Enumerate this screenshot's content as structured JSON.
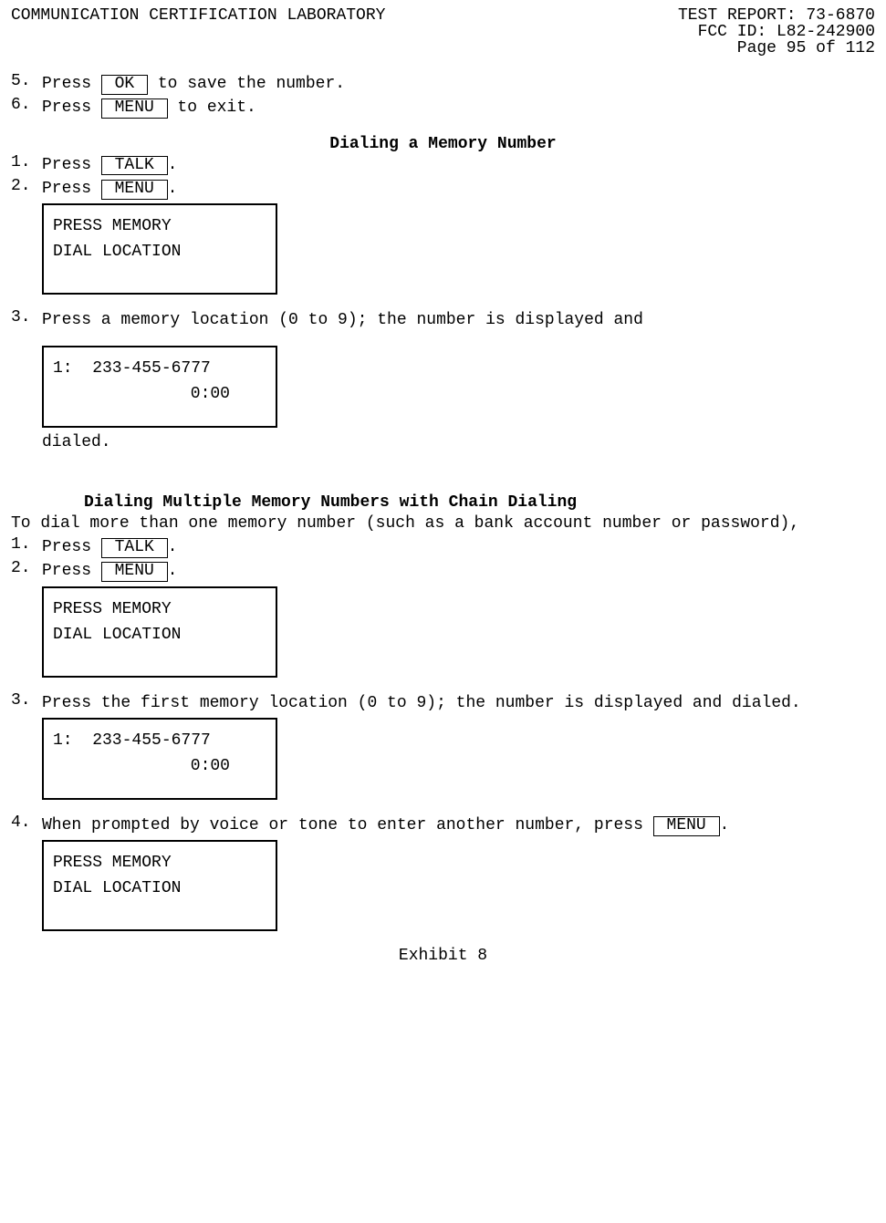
{
  "header": {
    "lab": "COMMUNICATION CERTIFICATION LABORATORY",
    "report": "TEST REPORT: 73-6870",
    "fcc": "FCC ID: L82-242900",
    "page": "Page 95 of 112"
  },
  "steps_a": {
    "s5_num": "5.",
    "s5_pre": "Press ",
    "s5_key": " OK ",
    "s5_post": " to save the number.",
    "s6_num": "6.",
    "s6_pre": "Press ",
    "s6_key": " MENU ",
    "s6_post": " to exit."
  },
  "section1": {
    "title": "Dialing a Memory Number",
    "s1_num": "1.",
    "s1_pre": "Press ",
    "s1_key": " TALK ",
    "s1_post": ".",
    "s2_num": "2.",
    "s2_pre": "Press ",
    "s2_key": " MENU ",
    "s2_post": ".",
    "display1_l1": "PRESS MEMORY",
    "display1_l2": "DIAL LOCATION",
    "s3_num": "3.",
    "s3_text": " Press a memory location (0 to 9); the number is displayed and",
    "display2_l1": "1:  233-455-6777",
    "display2_timer": "0:00",
    "s3_tail": "dialed."
  },
  "section2": {
    "title": "Dialing Multiple Memory Numbers with Chain Dialing",
    "intro": "To dial more than one memory number (such as a bank account number or password),",
    "s1_num": "1.",
    "s1_pre": "Press ",
    "s1_key": " TALK ",
    "s1_post": ".",
    "s2_num": "2.",
    "s2_pre": "Press ",
    "s2_key": " MENU ",
    "s2_post": ".",
    "display1_l1": "PRESS MEMORY",
    "display1_l2": "DIAL LOCATION",
    "s3_num": "3.",
    "s3_text": "Press the first memory location (0 to 9); the number is displayed and dialed.",
    "display2_l1": "1:  233-455-6777",
    "display2_timer": "0:00",
    "s4_num": "4.",
    "s4_pre": "When prompted by voice or tone to enter another number, press ",
    "s4_key": " MENU ",
    "s4_post": ".",
    "display3_l1": "PRESS MEMORY",
    "display3_l2": "DIAL LOCATION"
  },
  "footer": "Exhibit 8"
}
